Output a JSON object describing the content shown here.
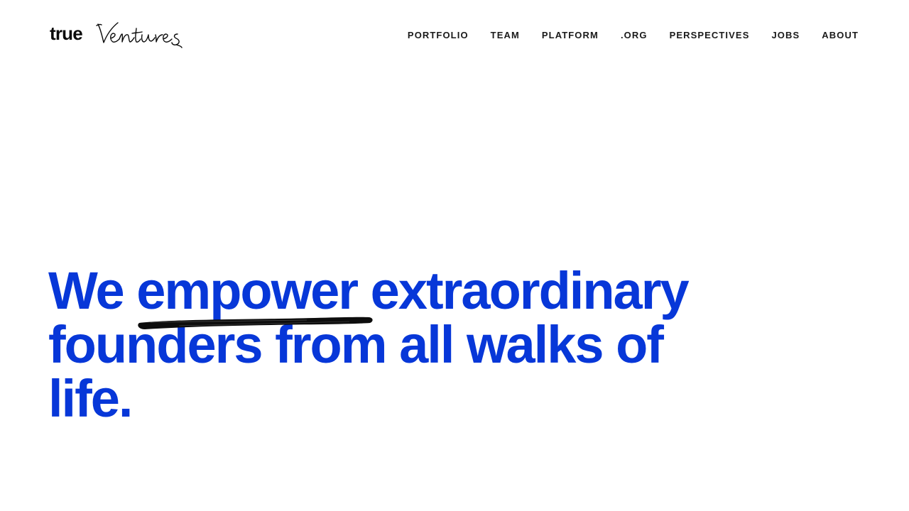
{
  "header": {
    "logo": {
      "word": "true",
      "script": "Ventures"
    },
    "nav": [
      {
        "label": "PORTFOLIO"
      },
      {
        "label": "TEAM"
      },
      {
        "label": "PLATFORM"
      },
      {
        "label": ".ORG"
      },
      {
        "label": "PERSPECTIVES"
      },
      {
        "label": "JOBS"
      },
      {
        "label": "ABOUT"
      }
    ]
  },
  "hero": {
    "before": "We ",
    "emphasis": "empower",
    "after": " extraordinary founders from all walks of life."
  },
  "colors": {
    "accent": "#0737d8",
    "text": "#1a1a1a",
    "background": "#ffffff"
  },
  "icons": {
    "underline": "brush-stroke-icon"
  }
}
